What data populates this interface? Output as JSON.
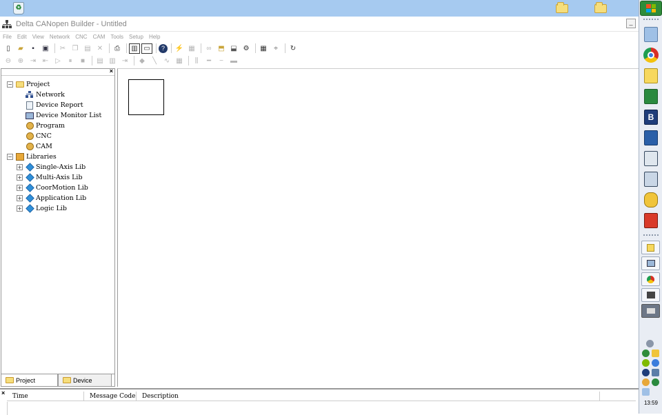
{
  "desktop": {
    "icons": [
      "recycle-bin-icon",
      "folder-icon",
      "folder-icon"
    ]
  },
  "window": {
    "title": "Delta CANopen Builder - Untitled",
    "minimize_label": "_"
  },
  "menu": {
    "items": [
      "File",
      "Edit",
      "View",
      "Network",
      "CNC",
      "CAM",
      "Tools",
      "Setup",
      "Help"
    ]
  },
  "toolbar1": {
    "buttons": [
      "new-icon",
      "open-icon",
      "save-icon",
      "save-all-icon",
      "cut-icon",
      "copy-icon",
      "paste-icon",
      "delete-icon",
      "print-icon",
      "layout-icon",
      "window-icon",
      "help-icon",
      "connect-icon",
      "monitor-icon",
      "link-icon",
      "upload-icon",
      "download-icon",
      "property-icon",
      "grid-icon",
      "split-icon",
      "refresh-icon"
    ]
  },
  "toolbar2": {
    "buttons": [
      "zoom-out-icon",
      "zoom-in-icon",
      "step-in-icon",
      "step-back-icon",
      "run-icon",
      "pause-icon",
      "stop-icon",
      "table-icon",
      "list-icon",
      "end-icon",
      "node-icon",
      "line-icon",
      "curve-icon",
      "matrix-icon",
      "align-icon",
      "h-line-icon",
      "minus-icon",
      "block-icon"
    ]
  },
  "tree": {
    "project_label": "Project",
    "project_children": [
      "Network",
      "Device Report",
      "Device Monitor List",
      "Program",
      "CNC",
      "CAM"
    ],
    "libraries_label": "Libraries",
    "libraries_children": [
      "Single-Axis Lib",
      "Multi-Axis Lib",
      "CoorMotion Lib",
      "Application Lib",
      "Logic Lib"
    ],
    "expanded_glyph": "−",
    "collapsed_glyph": "+"
  },
  "left_tabs": {
    "project": "Project",
    "device": "Device"
  },
  "close_glyph": "×",
  "message_table": {
    "columns": [
      "Time",
      "Message Code",
      "Description"
    ]
  },
  "taskbar": {
    "clock": "13:59",
    "accent": "#2f8c3a"
  }
}
